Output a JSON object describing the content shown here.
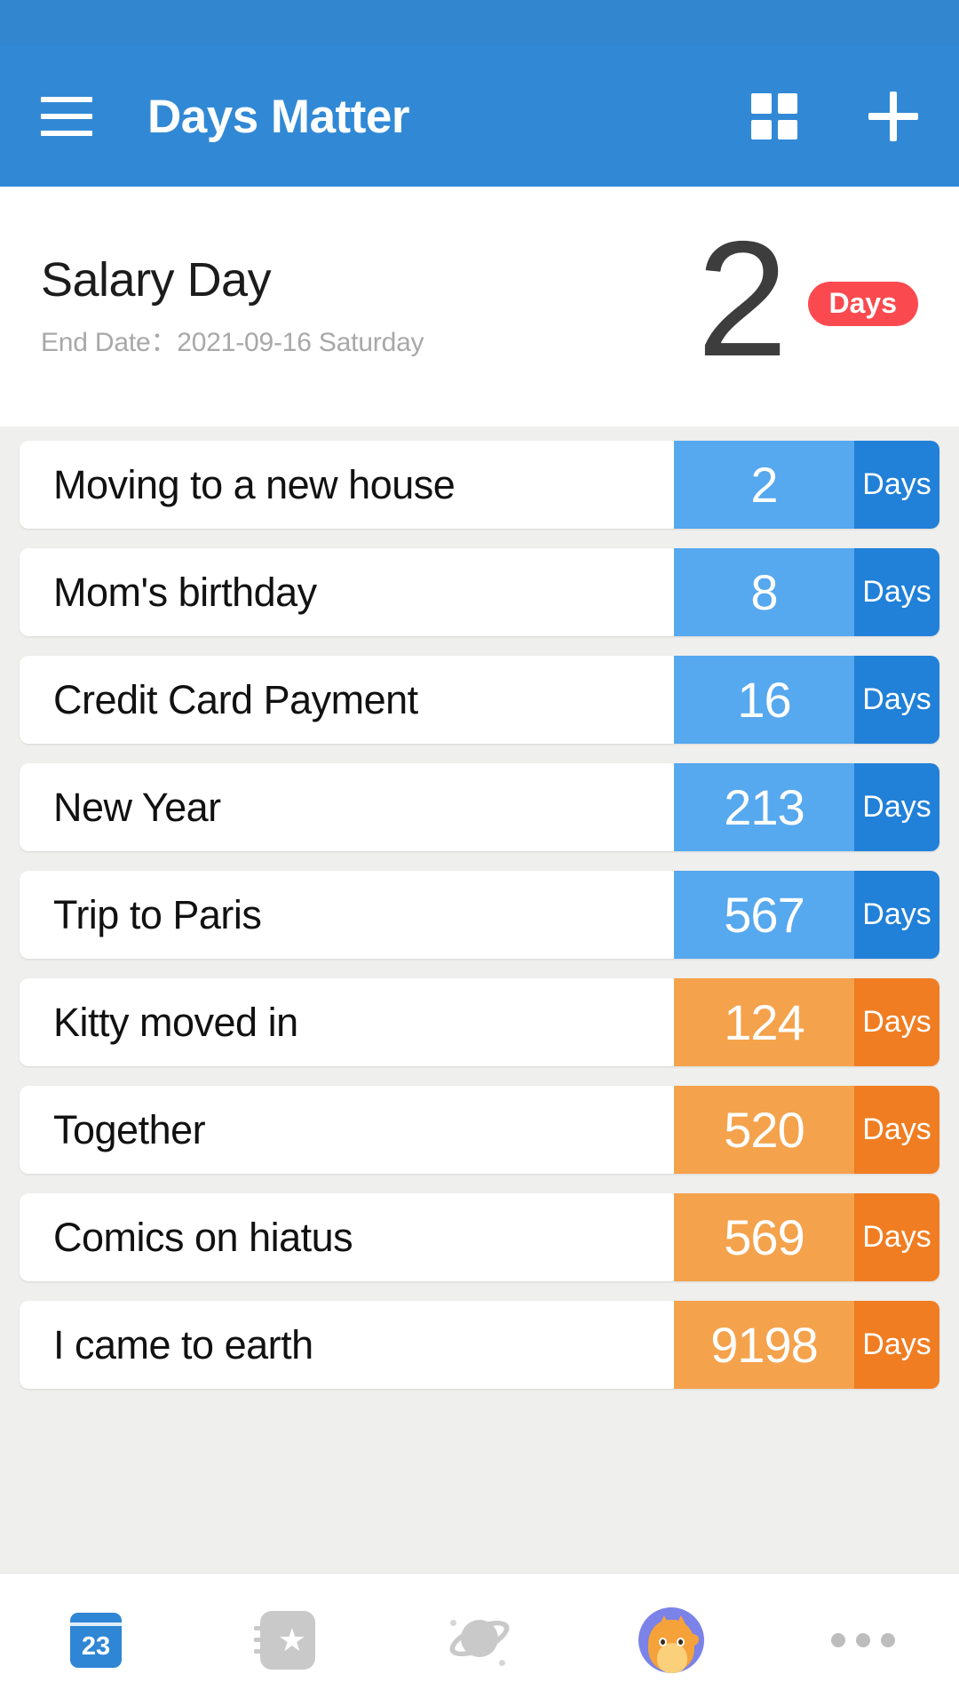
{
  "statusbar": {
    "color": "#3286cf"
  },
  "header": {
    "title": "Days Matter",
    "menu_icon": "hamburger-menu-icon",
    "grid_icon": "grid-view-icon",
    "add_icon": "plus-add-icon",
    "bg_color": "#3189d6"
  },
  "featured": {
    "title": "Salary Day",
    "end_date_label": "End Date：",
    "end_date_value": "2021-09-16 Saturday",
    "count": "2",
    "unit": "Days",
    "badge_color": "#fa4a4f"
  },
  "events": [
    {
      "name": "Moving to a new house",
      "count": "2",
      "unit": "Days",
      "color": "blue"
    },
    {
      "name": "Mom's birthday",
      "count": "8",
      "unit": "Days",
      "color": "blue"
    },
    {
      "name": "Credit Card Payment",
      "count": "16",
      "unit": "Days",
      "color": "blue"
    },
    {
      "name": "New Year",
      "count": "213",
      "unit": "Days",
      "color": "blue"
    },
    {
      "name": "Trip to Paris",
      "count": "567",
      "unit": "Days",
      "color": "blue"
    },
    {
      "name": "Kitty moved in",
      "count": "124",
      "unit": "Days",
      "color": "orange"
    },
    {
      "name": "Together",
      "count": "520",
      "unit": "Days",
      "color": "orange"
    },
    {
      "name": "Comics on hiatus",
      "count": "569",
      "unit": "Days",
      "color": "orange"
    },
    {
      "name": "I came to earth",
      "count": "9198",
      "unit": "Days",
      "color": "orange"
    }
  ],
  "colors": {
    "blue_count": "#56a8ef",
    "blue_unit": "#2180d8",
    "orange_count": "#f5a24c",
    "orange_unit": "#f07d22",
    "list_bg": "#efefed"
  },
  "bottomnav": {
    "items": [
      {
        "icon": "calendar-icon",
        "badge": "23",
        "active": true
      },
      {
        "icon": "notebook-star-icon",
        "active": false
      },
      {
        "icon": "planet-icon",
        "active": false
      },
      {
        "icon": "avatar-cat-icon",
        "active": false
      },
      {
        "icon": "more-dots-icon",
        "active": false
      }
    ]
  }
}
